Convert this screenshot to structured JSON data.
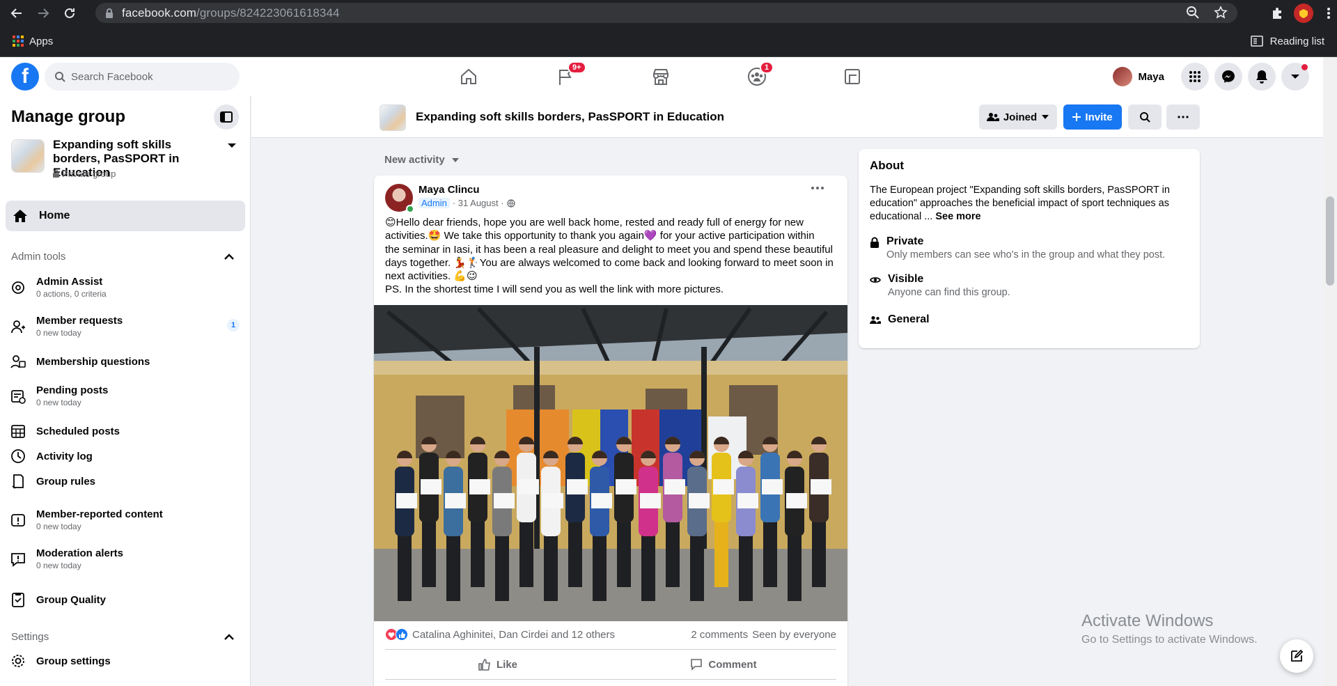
{
  "browser": {
    "url_host": "facebook.com",
    "url_path": "/groups/824223061618344",
    "bookmark_apps": "Apps",
    "reading_list": "Reading list"
  },
  "header": {
    "search_placeholder": "Search Facebook",
    "groups_badge": "9+",
    "friends_badge": "1",
    "profile_name": "Maya"
  },
  "sidebar": {
    "title": "Manage group",
    "group_name": "Expanding soft skills borders, PasSPORT in Education",
    "group_privacy": "Private group",
    "home": "Home",
    "admin_tools_label": "Admin tools",
    "items": [
      {
        "label": "Admin Assist",
        "sub": "0 actions, 0 criteria",
        "icon": "admin-assist-icon"
      },
      {
        "label": "Member requests",
        "sub": "0 new today",
        "icon": "member-requests-icon",
        "count": "1"
      },
      {
        "label": "Membership questions",
        "sub": "",
        "icon": "membership-questions-icon"
      },
      {
        "label": "Pending posts",
        "sub": "0 new today",
        "icon": "pending-posts-icon"
      },
      {
        "label": "Scheduled posts",
        "sub": "",
        "icon": "scheduled-posts-icon"
      },
      {
        "label": "Activity log",
        "sub": "",
        "icon": "activity-log-icon"
      },
      {
        "label": "Group rules",
        "sub": "",
        "icon": "group-rules-icon"
      },
      {
        "label": "Member-reported content",
        "sub": "0 new today",
        "icon": "reported-content-icon"
      },
      {
        "label": "Moderation alerts",
        "sub": "0 new today",
        "icon": "moderation-alerts-icon"
      },
      {
        "label": "Group Quality",
        "sub": "",
        "icon": "group-quality-icon"
      }
    ],
    "settings_label": "Settings",
    "settings_items": [
      {
        "label": "Group settings",
        "icon": "group-settings-icon"
      }
    ]
  },
  "group_bar": {
    "name": "Expanding soft skills borders, PasSPORT in Education",
    "joined": "Joined",
    "invite": "Invite"
  },
  "feed": {
    "sort_label": "New activity"
  },
  "post": {
    "author": "Maya Clincu",
    "role": "Admin",
    "date": "· 31 August ·",
    "text_lines": [
      "😊Hello dear friends, hope you are well back home, rested and ready full of energy for new",
      "activities.🤩 We take this opportunity to thank you again💜 for your active participation within",
      "the seminar in Iasi, it has been a real pleasure and delight to meet you and spend these beautiful",
      "days together. 💃🏌You are always welcomed to come back and looking forward to meet soon in",
      "next activities. 💪😉",
      "PS. In the shortest time I will send you as well the link with more pictures."
    ],
    "reactors": "Catalina Aghinitei, Dan Cirdei and 12 others",
    "comments": "2 comments",
    "seen": "Seen by everyone",
    "like": "Like",
    "comment": "Comment"
  },
  "about": {
    "title": "About",
    "description": "The European project \"Expanding soft skills borders, PasSPORT in education\" approaches the beneficial impact of sport techniques as educational ...",
    "see_more": "See more",
    "private_title": "Private",
    "private_sub": "Only members can see who's in the group and what they post.",
    "visible_title": "Visible",
    "visible_sub": "Anyone can find this group.",
    "general": "General"
  },
  "watermark": {
    "line1": "Activate Windows",
    "line2": "Go to Settings to activate Windows."
  },
  "colors": {
    "brand": "#1877f2",
    "badge": "#e41e3f"
  }
}
